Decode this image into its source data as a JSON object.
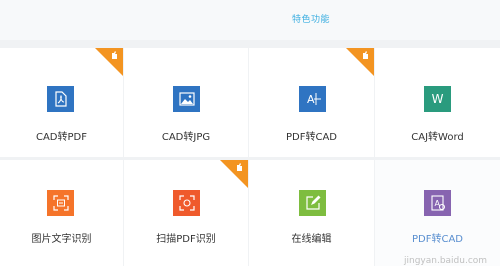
{
  "header": {
    "title": "特色功能"
  },
  "colors": {
    "accent": "#3aaee0",
    "hot": "#f39421",
    "blue": "#2f74c2",
    "teal": "#2a9b7e",
    "orange": "#f5742a",
    "orange_red": "#ef5a2c",
    "green": "#7ebd3f",
    "purple": "#8764b0"
  },
  "features": [
    {
      "label": "CAD转PDF",
      "icon": "pdf-document-icon",
      "hot": true
    },
    {
      "label": "CAD转JPG",
      "icon": "image-icon",
      "hot": false
    },
    {
      "label": "PDF转CAD",
      "icon": "cad-drawing-icon",
      "hot": true
    },
    {
      "label": "CAJ转Word",
      "icon": "word-icon",
      "hot": false
    },
    {
      "label": "图片文字识别",
      "icon": "text-recognition-icon",
      "hot": false
    },
    {
      "label": "扫描PDF识别",
      "icon": "scan-icon",
      "hot": true
    },
    {
      "label": "在线编辑",
      "icon": "edit-icon",
      "hot": false
    },
    {
      "label": "PDF转CAD",
      "icon": "text-document-icon",
      "hot": false
    }
  ],
  "watermark": {
    "text": "jingyan.baidu.com"
  }
}
